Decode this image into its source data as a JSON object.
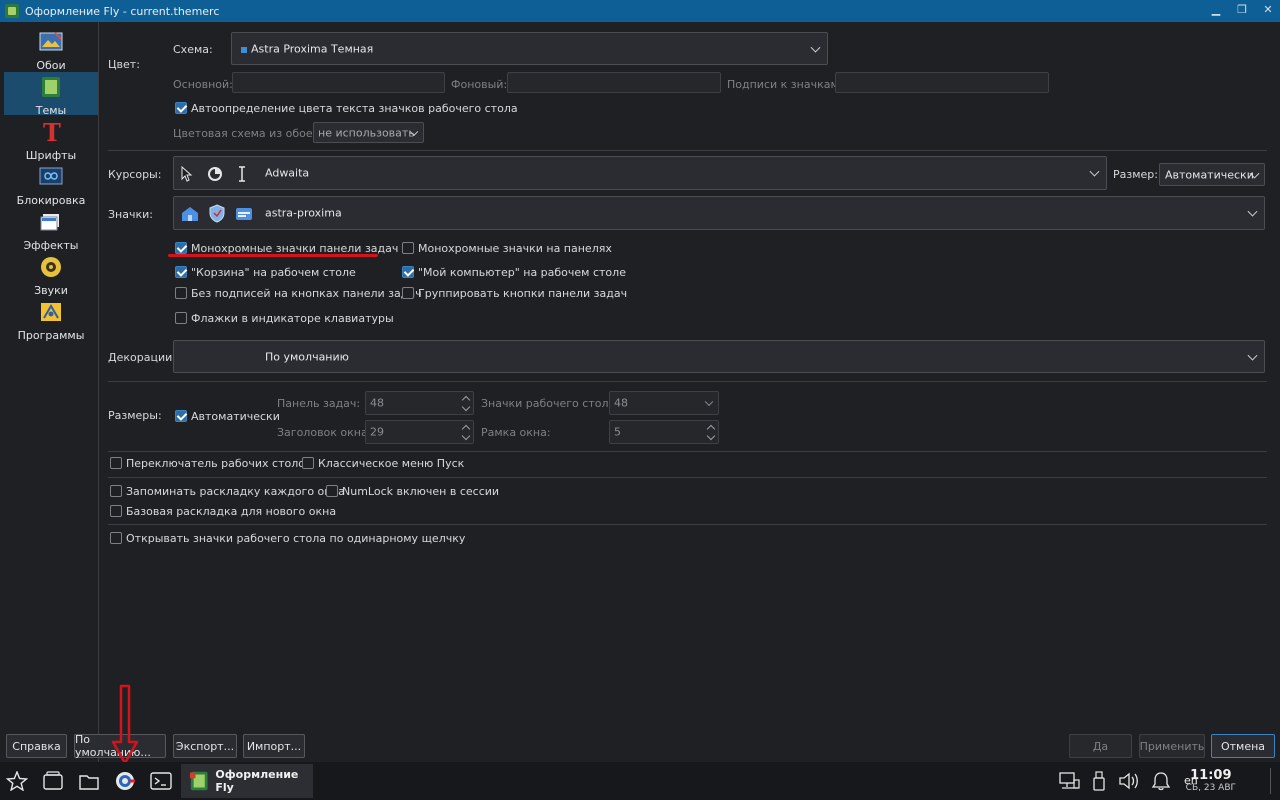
{
  "window": {
    "title": "Оформление Fly - current.themerc"
  },
  "sidebar": {
    "items": [
      {
        "label": "Обои",
        "icon": "wallpaper-icon"
      },
      {
        "label": "Темы",
        "icon": "themes-icon"
      },
      {
        "label": "Шрифты",
        "icon": "fonts-icon"
      },
      {
        "label": "Блокировка",
        "icon": "lock-screen-icon"
      },
      {
        "label": "Эффекты",
        "icon": "effects-icon"
      },
      {
        "label": "Звуки",
        "icon": "sounds-icon"
      },
      {
        "label": "Программы",
        "icon": "programs-icon"
      }
    ]
  },
  "color": {
    "section_label": "Цвет:",
    "scheme_label": "Схема:",
    "scheme_value": "Astra Proxima Темная",
    "base_label": "Основной:",
    "bg_label": "Фоновый:",
    "icon_caption_label": "Подписи к значкам:",
    "autodetect_label": "Автоопределение цвета текста значков рабочего стола",
    "from_wallpaper_label": "Цветовая схема из обоев:",
    "from_wallpaper_value": "не использовать"
  },
  "cursors": {
    "label": "Курсоры:",
    "value": "Adwaita",
    "size_label": "Размер:",
    "size_value": "Автоматически"
  },
  "icons": {
    "label": "Значки:",
    "value": "astra-proxima"
  },
  "checks": {
    "mono_taskbar": "Монохромные значки панели задач",
    "mono_panels": "Монохромные значки на панелях",
    "trash_desktop": "\"Корзина\" на рабочем столе",
    "mycomputer_desktop": "\"Мой компьютер\" на рабочем столе",
    "no_captions": "Без подписей на кнопках панели задач",
    "group_buttons": "Группировать кнопки панели задач",
    "kbd_flags": "Флажки в индикаторе клавиатуры"
  },
  "decorations": {
    "label": "Декорации:",
    "value": "По умолчанию"
  },
  "sizes": {
    "label": "Размеры:",
    "auto_label": "Автоматически",
    "taskbar_label": "Панель задач:",
    "taskbar_value": "48",
    "desktop_icons_label": "Значки рабочего стола:",
    "desktop_icons_value": "48",
    "titlebar_label": "Заголовок окна:",
    "titlebar_value": "29",
    "frame_label": "Рамка окна:",
    "frame_value": "5"
  },
  "extra": {
    "desk_switcher": "Переключатель рабочих столов",
    "classic_menu": "Классическое меню Пуск",
    "remember_layout": "Запоминать раскладку каждого окна",
    "numlock": "NumLock включен в сессии",
    "base_layout": "Базовая раскладка для нового окна",
    "single_click": "Открывать значки рабочего стола по одинарному щелчку"
  },
  "buttons": {
    "help": "Справка",
    "defaults": "По умолчанию...",
    "export": "Экспорт...",
    "import": "Импорт...",
    "yes": "Да",
    "apply": "Применить",
    "cancel": "Отмена"
  },
  "taskbar": {
    "task_label": "Оформление Fly",
    "lang": "en",
    "time": "11:09",
    "date": "СБ, 23 АВГ"
  },
  "colors": {
    "titlebar": "#0d5f96",
    "accent": "#2d6da3",
    "annotation": "#d4141c"
  }
}
